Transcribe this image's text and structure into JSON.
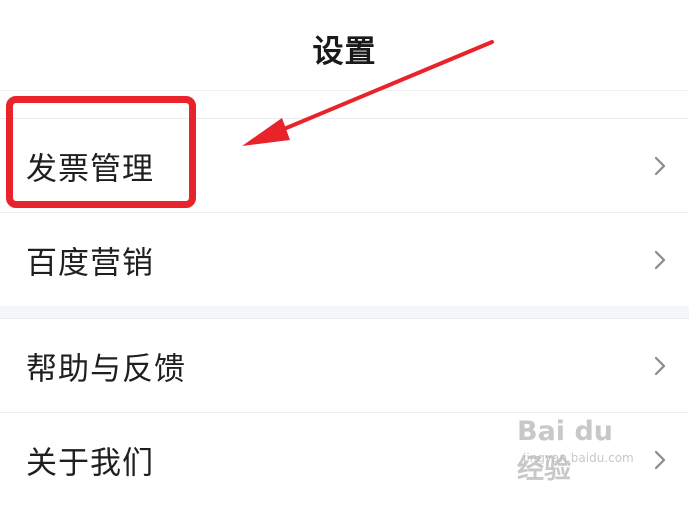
{
  "header": {
    "title": "设置"
  },
  "settings_groups": [
    {
      "items": [
        {
          "label": "发票管理"
        },
        {
          "label": "百度营销"
        }
      ]
    },
    {
      "items": [
        {
          "label": "帮助与反馈"
        },
        {
          "label": "关于我们"
        }
      ]
    }
  ],
  "annotation": {
    "highlight_color": "#e8232a",
    "highlighted_item": "发票管理"
  },
  "watermark": {
    "main": "Bai du 经验",
    "sub": "jingyan.baidu.com"
  },
  "icons": {
    "row_chevron": "chevron-right-icon"
  }
}
